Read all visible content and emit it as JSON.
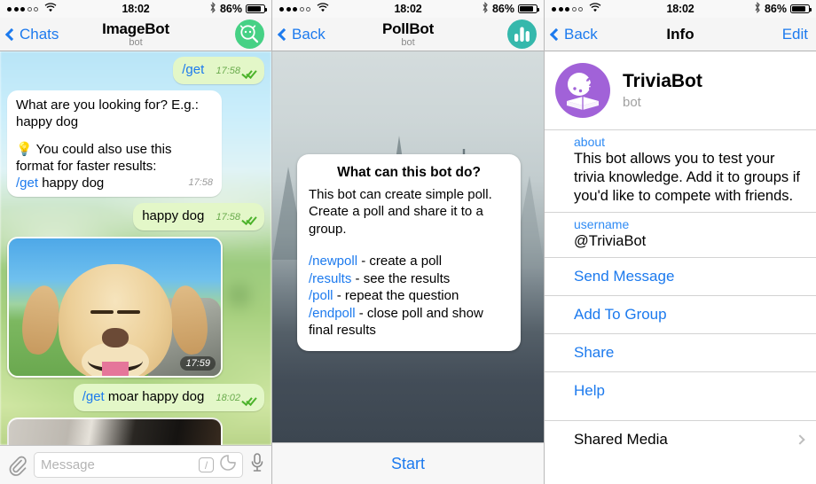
{
  "status_bar": {
    "time": "18:02",
    "battery_percent": "86%",
    "signal_icon": "signal-dots-icon",
    "wifi_icon": "wifi-icon",
    "bluetooth_icon": "bluetooth-icon",
    "battery_icon": "battery-icon"
  },
  "panel1": {
    "nav": {
      "back_label": "Chats",
      "title": "ImageBot",
      "subtitle": "bot",
      "avatar_icon": "imagebot-search-avatar-icon"
    },
    "messages": [
      {
        "id": "m1",
        "type": "outgoing",
        "command": "/get",
        "text": "",
        "time": "17:58",
        "status_icon": "double-check-icon"
      },
      {
        "id": "m2",
        "type": "incoming",
        "line1": "What are you looking for? E.g.: happy dog",
        "line2_icon": "lightbulb-icon",
        "line2": "You could also use this format for faster results:",
        "line3_command": "/get",
        "line3_text": " happy dog",
        "time": "17:58"
      },
      {
        "id": "m3",
        "type": "outgoing",
        "command": "",
        "text": "happy dog",
        "time": "17:58",
        "status_icon": "double-check-icon"
      },
      {
        "id": "m4",
        "type": "photo",
        "alt": "happy yellow labrador dog photo",
        "time": "17:59"
      },
      {
        "id": "m5",
        "type": "outgoing",
        "command": "/get",
        "text": " moar happy dog",
        "time": "18:02",
        "status_icon": "double-check-icon"
      },
      {
        "id": "m6",
        "type": "photo-partial",
        "alt": "second dog photo partially visible"
      }
    ],
    "input": {
      "attach_icon": "paperclip-icon",
      "placeholder": "Message",
      "command_icon": "slash-command-icon",
      "command_glyph": "/",
      "sticker_icon": "sticker-icon",
      "mic_icon": "microphone-icon"
    }
  },
  "panel2": {
    "nav": {
      "back_label": "Back",
      "title": "PollBot",
      "subtitle": "bot",
      "avatar_icon": "pollbot-chart-avatar-icon"
    },
    "card": {
      "heading": "What can this bot do?",
      "description": "This bot can create simple poll. Create a poll and share it to a group.",
      "commands": [
        {
          "cmd": "/newpoll",
          "desc": " - create a poll"
        },
        {
          "cmd": "/results",
          "desc": " - see the results"
        },
        {
          "cmd": "/poll",
          "desc": " - repeat the question"
        },
        {
          "cmd": "/endpoll",
          "desc": " - close poll and show final results"
        }
      ]
    },
    "start_button": "Start"
  },
  "panel3": {
    "nav": {
      "back_label": "Back",
      "title": "Info",
      "edit_label": "Edit"
    },
    "profile": {
      "name": "TriviaBot",
      "subtitle": "bot",
      "avatar_icon": "triviabot-book-avatar-icon"
    },
    "sections": [
      {
        "label": "about",
        "value": "This bot allows you to test your trivia knowledge. Add it to groups if you'd like to compete with friends."
      },
      {
        "label": "username",
        "value": "@TriviaBot"
      }
    ],
    "actions": [
      "Send Message",
      "Add To Group",
      "Share",
      "Help"
    ],
    "shared_media": {
      "label": "Shared Media",
      "chevron_icon": "chevron-right-icon"
    }
  },
  "colors": {
    "ios_blue": "#1c7aee",
    "outgoing_bubble": "#e3f7c8",
    "check_green": "#4cb32b",
    "imagebot_avatar": "#46d185",
    "pollbot_avatar": "#35b8ac",
    "triviabot_avatar": "#a162d8"
  }
}
